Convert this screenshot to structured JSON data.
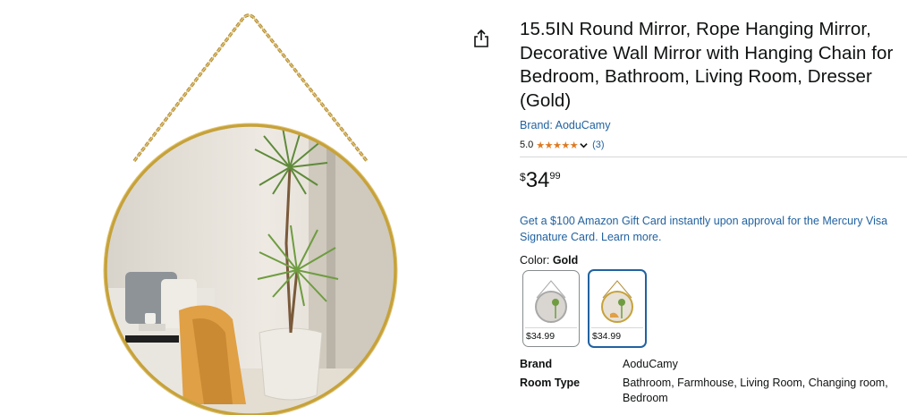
{
  "product": {
    "title": "15.5IN Round Mirror, Rope Hanging Mirror, Decorative Wall Mirror with Hanging Chain for Bedroom, Bathroom, Living Room, Dresser (Gold)",
    "brand_link": "Brand: AoduCamy",
    "rating_value": "5.0",
    "stars": "★★★★★",
    "review_count": "(3)",
    "price": {
      "symbol": "$",
      "whole": "34",
      "fraction": "99"
    },
    "promo": "Get a $100 Amazon Gift Card instantly upon approval for the Mercury Visa Signature Card. Learn more.",
    "color_label": "Color: ",
    "color_value": "Gold",
    "swatches": [
      {
        "price": "$34.99",
        "variant": "silver"
      },
      {
        "price": "$34.99",
        "variant": "gold",
        "selected": true
      }
    ],
    "specs": [
      {
        "key": "Brand",
        "value": "AoduCamy"
      },
      {
        "key": "Room Type",
        "value": "Bathroom, Farmhouse, Living Room, Changing room, Bedroom"
      }
    ]
  },
  "icons": {
    "share": "share-icon",
    "chevron": "chevron-down-icon"
  },
  "colors": {
    "link": "#2162a1",
    "star": "#de7921",
    "gold_frame": "#c6a23a",
    "divider": "#d5d9d9"
  }
}
